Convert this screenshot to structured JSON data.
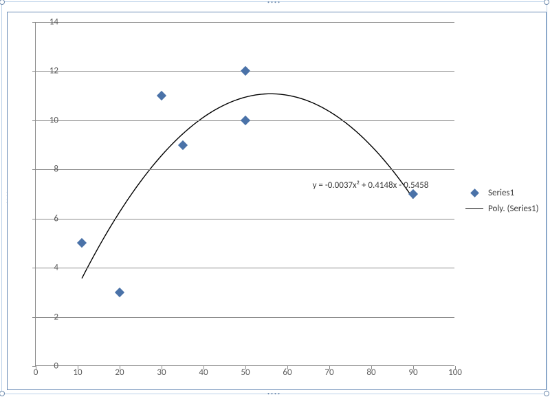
{
  "chart_data": {
    "type": "scatter",
    "x": [
      11,
      20,
      30,
      35,
      50,
      50,
      90
    ],
    "values": [
      5,
      3,
      11,
      9,
      12,
      10,
      7
    ],
    "title": "",
    "xlabel": "",
    "ylabel": "",
    "xlim": [
      0,
      100
    ],
    "ylim": [
      0,
      14
    ],
    "x_ticks": [
      0,
      10,
      20,
      30,
      40,
      50,
      60,
      70,
      80,
      90,
      100
    ],
    "y_ticks": [
      0,
      2,
      4,
      6,
      8,
      10,
      12,
      14
    ],
    "series_name": "Series1",
    "marker_color": "#4a72a8",
    "trendline": {
      "label": "Poly. (Series1)",
      "kind": "polynomial",
      "order": 2,
      "equation_text": "y = -0.0037x² + 0.4148x - 0.5458",
      "a": -0.0037,
      "b": 0.4148,
      "c": -0.5458,
      "draw_from_x": 11,
      "draw_to_x": 90,
      "line_color": "#000000"
    }
  },
  "legend": {
    "items": [
      {
        "label": "Series1"
      },
      {
        "label": "Poly. (Series1)"
      }
    ]
  }
}
